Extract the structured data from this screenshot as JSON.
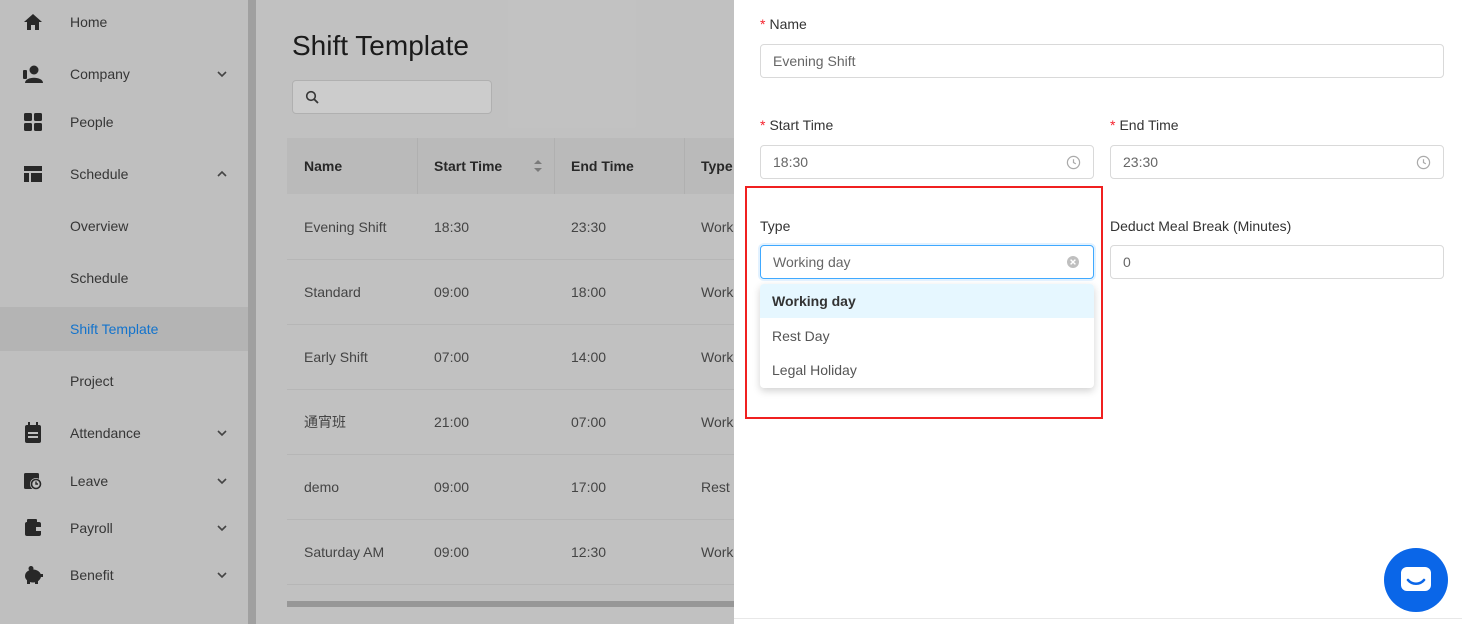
{
  "sidebar": {
    "items": [
      {
        "label": "Home",
        "icon": "home-icon",
        "expandable": false
      },
      {
        "label": "Company",
        "icon": "users-icon",
        "expandable": true
      },
      {
        "label": "People",
        "icon": "grid-icon",
        "expandable": false
      },
      {
        "label": "Schedule",
        "icon": "schedule-icon",
        "expandable": true,
        "expanded": true
      },
      {
        "label": "Overview",
        "sub": true
      },
      {
        "label": "Schedule",
        "sub": true
      },
      {
        "label": "Shift Template",
        "sub": true,
        "active": true
      },
      {
        "label": "Project",
        "sub": true
      },
      {
        "label": "Attendance",
        "icon": "calendar-icon",
        "expandable": true
      },
      {
        "label": "Leave",
        "icon": "clock-calendar-icon",
        "expandable": true
      },
      {
        "label": "Payroll",
        "icon": "wallet-icon",
        "expandable": true
      },
      {
        "label": "Benefit",
        "icon": "piggy-bank-icon",
        "expandable": true
      }
    ]
  },
  "page": {
    "title": "Shift Template",
    "search_placeholder": ""
  },
  "table": {
    "headers": [
      "Name",
      "Start Time",
      "End Time",
      "Type"
    ],
    "rows": [
      [
        "Evening Shift",
        "18:30",
        "23:30",
        "Work"
      ],
      [
        "Standard",
        "09:00",
        "18:00",
        "Work"
      ],
      [
        "Early Shift",
        "07:00",
        "14:00",
        "Work"
      ],
      [
        "通宵班",
        "21:00",
        "07:00",
        "Work"
      ],
      [
        "demo",
        "09:00",
        "17:00",
        "Rest"
      ],
      [
        "Saturday AM",
        "09:00",
        "12:30",
        "Work"
      ]
    ]
  },
  "form": {
    "name_label": "Name",
    "name_value": "Evening Shift",
    "start_label": "Start Time",
    "start_value": "18:30",
    "end_label": "End Time",
    "end_value": "23:30",
    "type_label": "Type",
    "type_value": "Working day",
    "meal_label": "Deduct Meal Break (Minutes)",
    "meal_value": "0",
    "type_options": [
      "Working day",
      "Rest Day",
      "Legal Holiday"
    ],
    "required_mark": "*"
  },
  "colors": {
    "accent": "#1890ff",
    "required": "#f5222d",
    "highlight": "#f02020",
    "chat": "#0a66e8"
  }
}
